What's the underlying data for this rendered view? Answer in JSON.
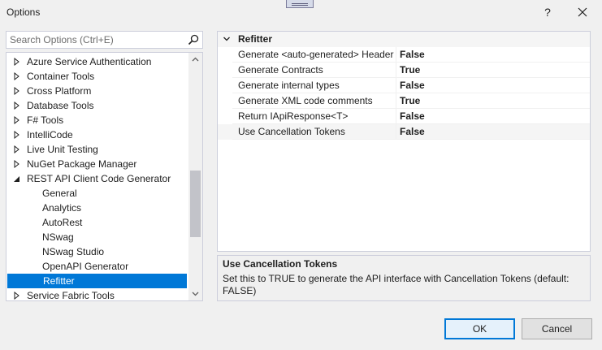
{
  "window": {
    "title": "Options",
    "help_label": "?",
    "close_label": "✕"
  },
  "search": {
    "placeholder": "Search Options (Ctrl+E)",
    "value": ""
  },
  "tree": {
    "items": [
      {
        "label": "Azure Service Authentication",
        "expandable": true,
        "expanded": false,
        "level": 0
      },
      {
        "label": "Container Tools",
        "expandable": true,
        "expanded": false,
        "level": 0
      },
      {
        "label": "Cross Platform",
        "expandable": true,
        "expanded": false,
        "level": 0
      },
      {
        "label": "Database Tools",
        "expandable": true,
        "expanded": false,
        "level": 0
      },
      {
        "label": "F# Tools",
        "expandable": true,
        "expanded": false,
        "level": 0
      },
      {
        "label": "IntelliCode",
        "expandable": true,
        "expanded": false,
        "level": 0
      },
      {
        "label": "Live Unit Testing",
        "expandable": true,
        "expanded": false,
        "level": 0
      },
      {
        "label": "NuGet Package Manager",
        "expandable": true,
        "expanded": false,
        "level": 0
      },
      {
        "label": "REST API Client Code Generator",
        "expandable": true,
        "expanded": true,
        "level": 0
      },
      {
        "label": "General",
        "expandable": false,
        "level": 1
      },
      {
        "label": "Analytics",
        "expandable": false,
        "level": 1
      },
      {
        "label": "AutoRest",
        "expandable": false,
        "level": 1
      },
      {
        "label": "NSwag",
        "expandable": false,
        "level": 1
      },
      {
        "label": "NSwag Studio",
        "expandable": false,
        "level": 1
      },
      {
        "label": "OpenAPI Generator",
        "expandable": false,
        "level": 1
      },
      {
        "label": "Refitter",
        "expandable": false,
        "level": 1,
        "selected": true
      },
      {
        "label": "Service Fabric Tools",
        "expandable": true,
        "expanded": false,
        "level": 0
      }
    ]
  },
  "property_grid": {
    "category": "Refitter",
    "properties": [
      {
        "name": "Generate <auto-generated> Header",
        "value": "False"
      },
      {
        "name": "Generate Contracts",
        "value": "True"
      },
      {
        "name": "Generate internal types",
        "value": "False"
      },
      {
        "name": "Generate XML code comments",
        "value": "True"
      },
      {
        "name": "Return IApiResponse<T>",
        "value": "False"
      },
      {
        "name": "Use Cancellation Tokens",
        "value": "False"
      }
    ]
  },
  "description": {
    "title": "Use Cancellation Tokens",
    "text": "Set this to TRUE to generate the API interface with Cancellation Tokens (default: FALSE)"
  },
  "buttons": {
    "ok_label": "OK",
    "cancel_label": "Cancel"
  },
  "colors": {
    "selection": "#0078d7",
    "ok_border": "#0078d7"
  }
}
